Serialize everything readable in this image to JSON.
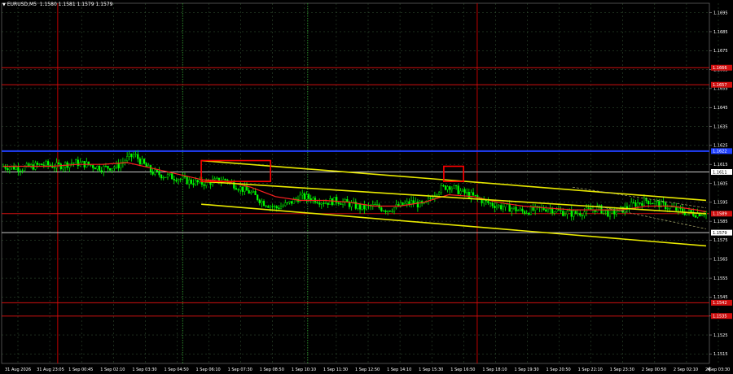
{
  "header": {
    "arrow": "▼",
    "symbol_text": "EURUSD,M5",
    "ohlc_text": "1.1580 1.1581 1.1579 1.1579"
  },
  "colors": {
    "background": "#000000",
    "grid": "#3a5a3a",
    "candle": "#00ff00",
    "ma": "#ff2020",
    "level_red": "#d01010",
    "level_blue": "#2040ff",
    "level_white": "#c8c8c8",
    "channel": "#e8e800",
    "box": "#ff0000",
    "vline_red": "#c00000",
    "vline_green": "#2a8a2a"
  },
  "price_axis": {
    "ticks": [
      "1.1695",
      "1.1685",
      "1.1675",
      "1.1665",
      "1.1655",
      "1.1645",
      "1.1635",
      "1.1625",
      "1.1615",
      "1.1605",
      "1.1595",
      "1.1585",
      "1.1575",
      "1.1565",
      "1.1555",
      "1.1545",
      "1.1535",
      "1.1525",
      "1.1515"
    ],
    "tick_values": [
      1.1695,
      1.1685,
      1.1675,
      1.1665,
      1.1655,
      1.1645,
      1.1635,
      1.1625,
      1.1615,
      1.1605,
      1.1595,
      1.1585,
      1.1575,
      1.1565,
      1.1555,
      1.1545,
      1.1535,
      1.1525,
      1.1515
    ],
    "min": 1.151,
    "max": 1.17
  },
  "time_axis": {
    "labels": [
      "31 Aug 2026",
      "31 Aug 23:05",
      "1 Sep 00:45",
      "1 Sep 02:10",
      "1 Sep 03:30",
      "1 Sep 04:50",
      "1 Sep 06:10",
      "1 Sep 07:30",
      "1 Sep 08:50",
      "1 Sep 10:10",
      "1 Sep 11:30",
      "1 Sep 12:50",
      "1 Sep 14:10",
      "1 Sep 15:30",
      "1 Sep 16:50",
      "1 Sep 18:10",
      "1 Sep 19:30",
      "1 Sep 20:50",
      "1 Sep 22:10",
      "1 Sep 23:30",
      "2 Sep 00:50",
      "2 Sep 02:10",
      "2 Sep 03:30"
    ]
  },
  "levels": [
    {
      "value": 1.1666,
      "label": "1.1666",
      "kind": "red",
      "badge": true
    },
    {
      "value": 1.1657,
      "label": "1.1657",
      "kind": "red",
      "badge": true
    },
    {
      "value": 1.1622,
      "label": "1.1622",
      "kind": "blue",
      "badge": true
    },
    {
      "value": 1.1611,
      "label": "1.1611",
      "kind": "white",
      "badge": true
    },
    {
      "value": 1.1589,
      "label": "1.1589",
      "kind": "red",
      "badge": true
    },
    {
      "value": 1.1579,
      "label": "1.1579",
      "kind": "white",
      "badge": true
    },
    {
      "value": 1.1542,
      "label": "1.1542",
      "kind": "red",
      "badge": true
    },
    {
      "value": 1.1535,
      "label": "1.1535",
      "kind": "red",
      "badge": true
    }
  ],
  "vertical_lines": [
    {
      "time_index": 2.2,
      "kind": "red"
    },
    {
      "time_index": 7.25,
      "kind": "green"
    },
    {
      "time_index": 12.3,
      "kind": "green"
    },
    {
      "time_index": 19.15,
      "kind": "red"
    }
  ],
  "chart_data": {
    "type": "candlestick",
    "symbol": "EURUSD",
    "timeframe": "M5",
    "price_path": [
      [
        0.0,
        1.1614
      ],
      [
        0.8,
        1.1613
      ],
      [
        1.6,
        1.1615
      ],
      [
        2.2,
        1.1614
      ],
      [
        2.8,
        1.1616
      ],
      [
        3.4,
        1.1615
      ],
      [
        4.0,
        1.1613
      ],
      [
        4.6,
        1.1614
      ],
      [
        5.0,
        1.1618
      ],
      [
        5.3,
        1.162
      ],
      [
        5.6,
        1.1616
      ],
      [
        6.0,
        1.1611
      ],
      [
        6.5,
        1.1609
      ],
      [
        7.0,
        1.1608
      ],
      [
        7.5,
        1.1606
      ],
      [
        8.0,
        1.1605
      ],
      [
        8.5,
        1.1606
      ],
      [
        9.0,
        1.1607
      ],
      [
        9.5,
        1.1603
      ],
      [
        10.0,
        1.16
      ],
      [
        10.5,
        1.1595
      ],
      [
        11.0,
        1.1592
      ],
      [
        11.5,
        1.1594
      ],
      [
        12.0,
        1.1598
      ],
      [
        12.5,
        1.1597
      ],
      [
        13.0,
        1.1595
      ],
      [
        13.5,
        1.1596
      ],
      [
        14.0,
        1.1594
      ],
      [
        14.5,
        1.1592
      ],
      [
        15.0,
        1.1593
      ],
      [
        15.5,
        1.1591
      ],
      [
        16.0,
        1.1593
      ],
      [
        16.5,
        1.1595
      ],
      [
        17.0,
        1.1593
      ],
      [
        17.5,
        1.1601
      ],
      [
        18.0,
        1.1604
      ],
      [
        18.4,
        1.1601
      ],
      [
        19.0,
        1.1598
      ],
      [
        19.5,
        1.1595
      ],
      [
        20.0,
        1.1593
      ],
      [
        20.5,
        1.1592
      ],
      [
        21.0,
        1.159
      ],
      [
        21.5,
        1.1591
      ],
      [
        22.0,
        1.1592
      ],
      [
        22.5,
        1.159
      ],
      [
        23.0,
        1.1589
      ],
      [
        23.5,
        1.159
      ],
      [
        24.0,
        1.1592
      ],
      [
        24.5,
        1.1589
      ],
      [
        25.0,
        1.1591
      ],
      [
        25.5,
        1.1594
      ],
      [
        26.0,
        1.1596
      ],
      [
        26.5,
        1.1594
      ],
      [
        27.0,
        1.1592
      ],
      [
        27.5,
        1.159
      ],
      [
        28.0,
        1.1589
      ],
      [
        28.4,
        1.159
      ]
    ],
    "ma_path": [
      [
        0.0,
        1.1614
      ],
      [
        1.0,
        1.1614
      ],
      [
        2.0,
        1.1614
      ],
      [
        3.0,
        1.1615
      ],
      [
        4.0,
        1.1615
      ],
      [
        5.0,
        1.1616
      ],
      [
        6.0,
        1.1613
      ],
      [
        7.0,
        1.161
      ],
      [
        8.0,
        1.1607
      ],
      [
        9.0,
        1.1606
      ],
      [
        10.0,
        1.1603
      ],
      [
        11.0,
        1.1598
      ],
      [
        12.0,
        1.1596
      ],
      [
        13.0,
        1.1596
      ],
      [
        14.0,
        1.1595
      ],
      [
        15.0,
        1.1593
      ],
      [
        16.0,
        1.1593
      ],
      [
        17.0,
        1.1595
      ],
      [
        18.0,
        1.1599
      ],
      [
        19.0,
        1.1598
      ],
      [
        20.0,
        1.1595
      ],
      [
        21.0,
        1.1593
      ],
      [
        22.0,
        1.1592
      ],
      [
        23.0,
        1.1591
      ],
      [
        24.0,
        1.1591
      ],
      [
        25.0,
        1.1591
      ],
      [
        26.0,
        1.1593
      ],
      [
        27.0,
        1.1593
      ],
      [
        28.0,
        1.1591
      ],
      [
        28.4,
        1.159
      ]
    ],
    "channel_lines": [
      {
        "from": [
          8.0,
          1.1617
        ],
        "to": [
          28.4,
          1.1596
        ]
      },
      {
        "from": [
          8.0,
          1.1606
        ],
        "to": [
          28.4,
          1.1589
        ]
      },
      {
        "from": [
          8.0,
          1.1594
        ],
        "to": [
          28.4,
          1.1572
        ]
      }
    ],
    "dashed_lines": [
      {
        "from": [
          23.0,
          1.1603
        ],
        "to": [
          28.4,
          1.1592
        ]
      },
      {
        "from": [
          24.0,
          1.1593
        ],
        "to": [
          28.4,
          1.1581
        ]
      }
    ],
    "boxes": [
      {
        "from": [
          8.0,
          1.1617
        ],
        "to": [
          10.8,
          1.1606
        ]
      },
      {
        "from": [
          17.8,
          1.1614
        ],
        "to": [
          18.6,
          1.1606
        ]
      }
    ]
  }
}
